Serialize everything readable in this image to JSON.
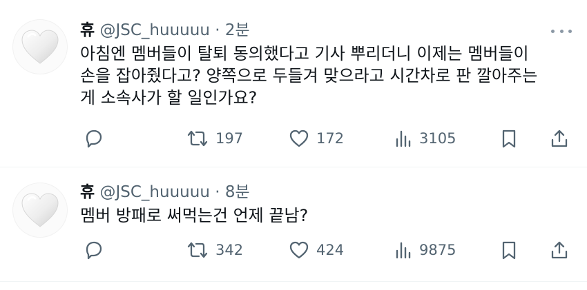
{
  "tweets": [
    {
      "name": "휴",
      "handle": "@JSC_huuuuu",
      "separator": "·",
      "time": "2분",
      "text_lines": [
        "아침엔 멤버들이 탈퇴 동의했다고 기사 뿌리더니 이제는 멤버들이",
        "손을 잡아줬다고? 양쪽으로 두들겨 맞으라고 시간차로 판 깔아주는",
        "게 소속사가 할 일인가요?"
      ],
      "retweets": "197",
      "likes": "172",
      "views": "3105"
    },
    {
      "name": "휴",
      "handle": "@JSC_huuuuu",
      "separator": "·",
      "time": "8분",
      "text_lines": [
        "멤버 방패로 써먹는건 언제 끝남?"
      ],
      "retweets": "342",
      "likes": "424",
      "views": "9875"
    }
  ],
  "icons": {
    "reply": "reply-icon",
    "retweet": "retweet-icon",
    "like": "heart-icon",
    "views": "views-icon",
    "bookmark": "bookmark-icon",
    "share": "share-icon",
    "more": "more-icon",
    "avatar": "heart-avatar"
  },
  "colors": {
    "text": "#0f1419",
    "secondary": "#536471",
    "divider": "#eff3f4"
  }
}
